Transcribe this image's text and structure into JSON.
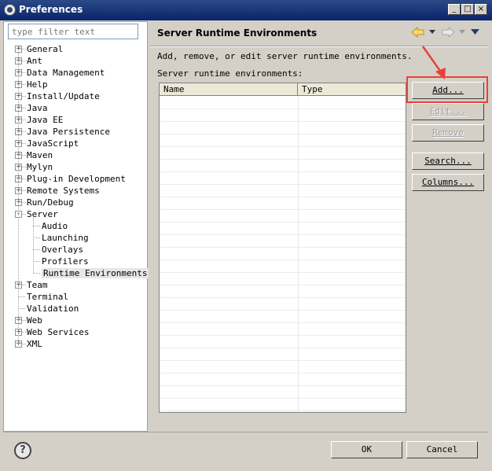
{
  "window": {
    "title": "Preferences",
    "controls": {
      "minimize": "_",
      "maximize": "□",
      "close": "×"
    }
  },
  "filter": {
    "placeholder": "type filter text"
  },
  "tree": [
    {
      "label": "General",
      "level": 0,
      "expander": "+"
    },
    {
      "label": "Ant",
      "level": 0,
      "expander": "+"
    },
    {
      "label": "Data Management",
      "level": 0,
      "expander": "+"
    },
    {
      "label": "Help",
      "level": 0,
      "expander": "+"
    },
    {
      "label": "Install/Update",
      "level": 0,
      "expander": "+"
    },
    {
      "label": "Java",
      "level": 0,
      "expander": "+"
    },
    {
      "label": "Java EE",
      "level": 0,
      "expander": "+"
    },
    {
      "label": "Java Persistence",
      "level": 0,
      "expander": "+"
    },
    {
      "label": "JavaScript",
      "level": 0,
      "expander": "+"
    },
    {
      "label": "Maven",
      "level": 0,
      "expander": "+"
    },
    {
      "label": "Mylyn",
      "level": 0,
      "expander": "+"
    },
    {
      "label": "Plug-in Development",
      "level": 0,
      "expander": "+"
    },
    {
      "label": "Remote Systems",
      "level": 0,
      "expander": "+"
    },
    {
      "label": "Run/Debug",
      "level": 0,
      "expander": "+"
    },
    {
      "label": "Server",
      "level": 0,
      "expander": "-"
    },
    {
      "label": "Audio",
      "level": 1,
      "expander": ""
    },
    {
      "label": "Launching",
      "level": 1,
      "expander": ""
    },
    {
      "label": "Overlays",
      "level": 1,
      "expander": ""
    },
    {
      "label": "Profilers",
      "level": 1,
      "expander": ""
    },
    {
      "label": "Runtime Environments",
      "level": 1,
      "expander": "",
      "selected": true
    },
    {
      "label": "Team",
      "level": 0,
      "expander": "+"
    },
    {
      "label": "Terminal",
      "level": 0,
      "expander": ""
    },
    {
      "label": "Validation",
      "level": 0,
      "expander": ""
    },
    {
      "label": "Web",
      "level": 0,
      "expander": "+"
    },
    {
      "label": "Web Services",
      "level": 0,
      "expander": "+"
    },
    {
      "label": "XML",
      "level": 0,
      "expander": "+"
    }
  ],
  "page": {
    "title": "Server Runtime Environments",
    "description": "Add, remove, or edit server runtime environments.",
    "list_label": "Server runtime environments:",
    "columns": [
      "Name",
      "Type"
    ],
    "nav_icons": [
      "back-arrow-icon",
      "forward-arrow-icon",
      "view-menu-icon"
    ]
  },
  "buttons": {
    "add": "Add...",
    "edit": "Edit...",
    "remove": "Remove",
    "search": "Search...",
    "columns": "Columns..."
  },
  "footer": {
    "ok": "OK",
    "cancel": "Cancel",
    "help_glyph": "?"
  },
  "colors": {
    "titlebar": "#0a246a",
    "annotation": "#e8413a",
    "dialog_bg": "#d4d0c8"
  }
}
